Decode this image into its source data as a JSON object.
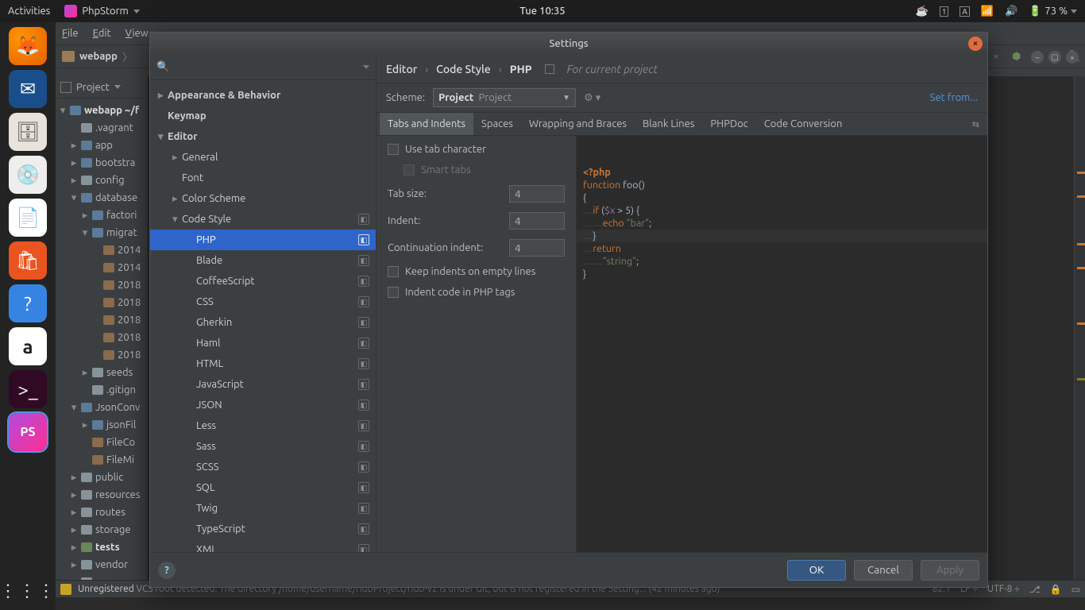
{
  "topbar": {
    "activities": "Activities",
    "app": "PhpStorm",
    "clock": "Tue 10:35",
    "battery": "73 %"
  },
  "menu": {
    "file": "File",
    "edit": "Edit",
    "view": "View"
  },
  "breadcrumb": {
    "root": "webapp"
  },
  "project_panel": {
    "title": "Project",
    "tree": [
      {
        "d": 0,
        "arr": "d",
        "icon": "fb",
        "label": "webapp",
        "suffix": " ~/f",
        "bold": true
      },
      {
        "d": 1,
        "arr": "",
        "icon": "fi",
        "label": ".vagrant"
      },
      {
        "d": 1,
        "arr": "r",
        "icon": "fb",
        "label": "app"
      },
      {
        "d": 1,
        "arr": "r",
        "icon": "fb",
        "label": "bootstra"
      },
      {
        "d": 1,
        "arr": "r",
        "icon": "fi",
        "label": "config"
      },
      {
        "d": 1,
        "arr": "d",
        "icon": "fb",
        "label": "database"
      },
      {
        "d": 2,
        "arr": "r",
        "icon": "fb",
        "label": "factori"
      },
      {
        "d": 2,
        "arr": "d",
        "icon": "fb",
        "label": "migrat"
      },
      {
        "d": 3,
        "arr": "",
        "icon": "db",
        "label": "2014"
      },
      {
        "d": 3,
        "arr": "",
        "icon": "db",
        "label": "2014"
      },
      {
        "d": 3,
        "arr": "",
        "icon": "db",
        "label": "2018"
      },
      {
        "d": 3,
        "arr": "",
        "icon": "db",
        "label": "2018"
      },
      {
        "d": 3,
        "arr": "",
        "icon": "db",
        "label": "2018"
      },
      {
        "d": 3,
        "arr": "",
        "icon": "db",
        "label": "2018"
      },
      {
        "d": 3,
        "arr": "",
        "icon": "db",
        "label": "2018"
      },
      {
        "d": 2,
        "arr": "r",
        "icon": "fi",
        "label": "seeds"
      },
      {
        "d": 2,
        "arr": "",
        "icon": "fi",
        "label": ".gitign"
      },
      {
        "d": 1,
        "arr": "d",
        "icon": "fb",
        "label": "JsonConv"
      },
      {
        "d": 2,
        "arr": "r",
        "icon": "fb",
        "label": "jsonFil"
      },
      {
        "d": 2,
        "arr": "",
        "icon": "db",
        "label": "FileCo"
      },
      {
        "d": 2,
        "arr": "",
        "icon": "db",
        "label": "FileMi"
      },
      {
        "d": 1,
        "arr": "r",
        "icon": "fi",
        "label": "public"
      },
      {
        "d": 1,
        "arr": "r",
        "icon": "fi",
        "label": "resources"
      },
      {
        "d": 1,
        "arr": "r",
        "icon": "fi",
        "label": "routes"
      },
      {
        "d": 1,
        "arr": "r",
        "icon": "fi",
        "label": "storage"
      },
      {
        "d": 1,
        "arr": "r",
        "icon": "fg",
        "label": "tests",
        "bold": true
      },
      {
        "d": 1,
        "arr": "r",
        "icon": "fi",
        "label": "vendor"
      },
      {
        "d": 1,
        "arr": "",
        "icon": "fi",
        "label": "env"
      }
    ]
  },
  "dialog": {
    "title": "Settings",
    "search_placeholder": "",
    "categories": [
      {
        "label": "Appearance & Behavior",
        "lvl": 0,
        "arr": "r",
        "bold": true
      },
      {
        "label": "Keymap",
        "lvl": 0,
        "bold": true
      },
      {
        "label": "Editor",
        "lvl": 0,
        "arr": "d",
        "bold": true
      },
      {
        "label": "General",
        "lvl": 1,
        "arr": "r"
      },
      {
        "label": "Font",
        "lvl": 1
      },
      {
        "label": "Color Scheme",
        "lvl": 1,
        "arr": "r"
      },
      {
        "label": "Code Style",
        "lvl": 1,
        "arr": "d",
        "badge": true
      },
      {
        "label": "PHP",
        "lvl": 2,
        "sel": true,
        "badge": true
      },
      {
        "label": "Blade",
        "lvl": 2,
        "badge": true
      },
      {
        "label": "CoffeeScript",
        "lvl": 2,
        "badge": true
      },
      {
        "label": "CSS",
        "lvl": 2,
        "badge": true
      },
      {
        "label": "Gherkin",
        "lvl": 2,
        "badge": true
      },
      {
        "label": "Haml",
        "lvl": 2,
        "badge": true
      },
      {
        "label": "HTML",
        "lvl": 2,
        "badge": true
      },
      {
        "label": "JavaScript",
        "lvl": 2,
        "badge": true
      },
      {
        "label": "JSON",
        "lvl": 2,
        "badge": true
      },
      {
        "label": "Less",
        "lvl": 2,
        "badge": true
      },
      {
        "label": "Sass",
        "lvl": 2,
        "badge": true
      },
      {
        "label": "SCSS",
        "lvl": 2,
        "badge": true
      },
      {
        "label": "SQL",
        "lvl": 2,
        "badge": true
      },
      {
        "label": "Twig",
        "lvl": 2,
        "badge": true
      },
      {
        "label": "TypeScript",
        "lvl": 2,
        "badge": true
      },
      {
        "label": "XML",
        "lvl": 2,
        "badge": true
      }
    ],
    "bread": {
      "a": "Editor",
      "b": "Code Style",
      "c": "PHP",
      "hint": "For current project"
    },
    "scheme_label": "Scheme:",
    "scheme_value": "Project",
    "scheme_value2": "Project",
    "set_from": "Set from...",
    "tabs": [
      "Tabs and Indents",
      "Spaces",
      "Wrapping and Braces",
      "Blank Lines",
      "PHPDoc",
      "Code Conversion"
    ],
    "active_tab": 0,
    "form": {
      "use_tab": "Use tab character",
      "smart_tabs": "Smart tabs",
      "tab_size_label": "Tab size:",
      "tab_size": "4",
      "indent_label": "Indent:",
      "indent": "4",
      "cont_label": "Continuation indent:",
      "cont": "4",
      "keep_empty": "Keep indents on empty lines",
      "indent_php": "Indent code in PHP tags"
    },
    "buttons": {
      "ok": "OK",
      "cancel": "Cancel",
      "apply": "Apply"
    }
  },
  "status": {
    "msg": "Unregistered VCS root detected: The directory /home/username/fldbProject/fldb-v2 is under Git, but is not registered in the Setting... (42 minutes ago)",
    "pos": "82:1",
    "lf": "LF",
    "enc": "UTF-8"
  }
}
